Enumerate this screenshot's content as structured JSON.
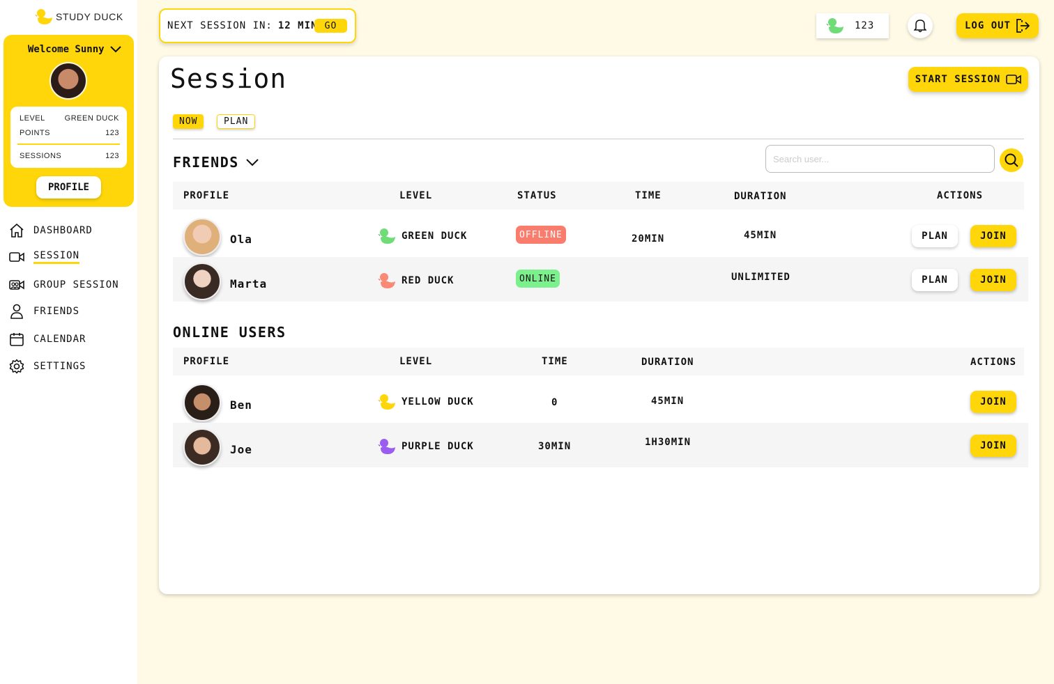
{
  "app": {
    "name": "STUDY DUCK"
  },
  "sidebar": {
    "welcome": "Welcome Sunny",
    "stats": {
      "level_label": "LEVEL",
      "level_value": "GREEN DUCK",
      "points_label": "POINTS",
      "points_value": "123",
      "sessions_label": "SESSIONS",
      "sessions_value": "123"
    },
    "profile_button": "PROFILE",
    "nav": [
      {
        "label": "DASHBOARD",
        "icon": "home-icon"
      },
      {
        "label": "SESSION",
        "icon": "video-camera-icon",
        "active": true
      },
      {
        "label": "GROUP SESSION",
        "icon": "group-video-icon"
      },
      {
        "label": "FRIENDS",
        "icon": "person-icon"
      },
      {
        "label": "CALENDAR",
        "icon": "calendar-icon"
      },
      {
        "label": "SETTINGS",
        "icon": "gear-icon"
      }
    ]
  },
  "topbar": {
    "next_session_label": "NEXT SESSION IN:",
    "next_session_time": "12 MIN",
    "go_label": "GO",
    "points": "123",
    "logout_label": "LOG OUT"
  },
  "main": {
    "title": "Session",
    "start_session_label": "START SESSION",
    "tabs": [
      "NOW",
      "PLAN"
    ],
    "friends": {
      "title": "FRIENDS",
      "search_placeholder": "Search user...",
      "columns": [
        "PROFILE",
        "LEVEL",
        "STATUS",
        "TIME",
        "DURATION",
        "ACTIONS"
      ],
      "rows": [
        {
          "name": "Ola",
          "level": "GREEN DUCK",
          "duck_color": "#6fdc78",
          "status": "OFFLINE",
          "time": "20MIN",
          "duration": "45MIN",
          "plan": "PLAN",
          "join": "JOIN"
        },
        {
          "name": "Marta",
          "level": "RED DUCK",
          "duck_color": "#f98a76",
          "status": "ONLINE",
          "time": "",
          "duration": "UNLIMITED",
          "plan": "PLAN",
          "join": "JOIN"
        }
      ]
    },
    "online": {
      "title": "ONLINE USERS",
      "columns": [
        "PROFILE",
        "LEVEL",
        "TIME",
        "DURATION",
        "ACTIONS"
      ],
      "rows": [
        {
          "name": "Ben",
          "level": "YELLOW DUCK",
          "duck_color": "#ffd60a",
          "time": "0",
          "duration": "45MIN",
          "join": "JOIN"
        },
        {
          "name": "Joe",
          "level": "PURPLE DUCK",
          "duck_color": "#9b5cf0",
          "time": "30MIN",
          "duration": "1H30MIN",
          "join": "JOIN"
        }
      ]
    }
  },
  "colors": {
    "accent": "#ffd60a",
    "background": "#fffae6",
    "offline": "#fa7c6c",
    "online": "#7cf08c"
  }
}
